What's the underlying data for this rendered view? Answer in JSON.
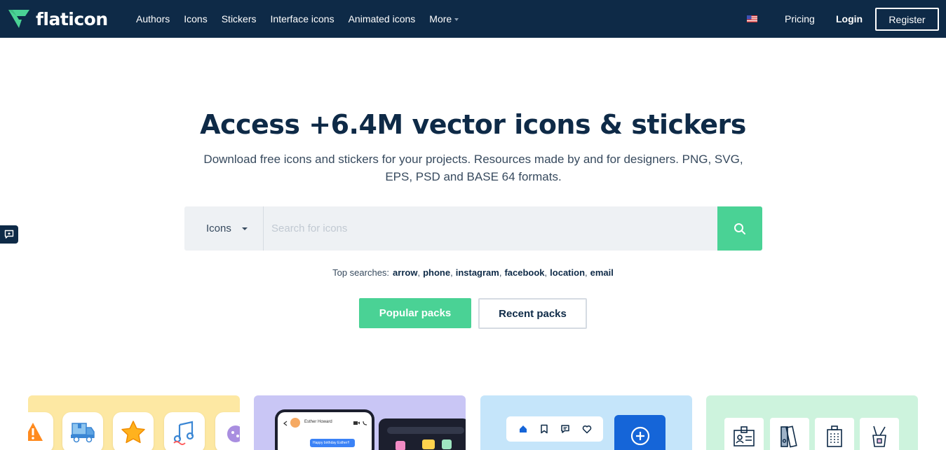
{
  "brand": {
    "name": "flaticon",
    "mark_color": "#4ad295",
    "nav_bg": "#0e2a47"
  },
  "nav": {
    "links": [
      "Authors",
      "Icons",
      "Stickers",
      "Interface icons",
      "Animated icons"
    ],
    "more_label": "More",
    "pricing_label": "Pricing",
    "login_label": "Login",
    "register_label": "Register",
    "language_icon": "us-flag-icon"
  },
  "hero": {
    "title": "Access +6.4M vector icons & stickers",
    "subtitle": "Download free icons and stickers for your projects. Resources made by and for designers. PNG, SVG, EPS, PSD and BASE 64 formats."
  },
  "search": {
    "type_selected": "Icons",
    "placeholder": "Search for icons",
    "value": "",
    "button_icon": "search-icon",
    "accent": "#4ad295"
  },
  "top_searches": {
    "label": "Top searches:",
    "terms": [
      "arrow",
      "phone",
      "instagram",
      "facebook",
      "location",
      "email"
    ]
  },
  "buttons": {
    "popular_packs": "Popular packs",
    "recent_packs": "Recent packs"
  },
  "cards": [
    {
      "name": "sticker-icons-card",
      "bg": "#fde8a3"
    },
    {
      "name": "chat-ui-card",
      "bg": "#c9c6f5",
      "contact_name": "Esther Howard",
      "message": "Happy birthday Esther!!"
    },
    {
      "name": "interface-icons-card",
      "bg": "#c5e5fa"
    },
    {
      "name": "line-icons-card",
      "bg": "#cdf3dd"
    }
  ]
}
